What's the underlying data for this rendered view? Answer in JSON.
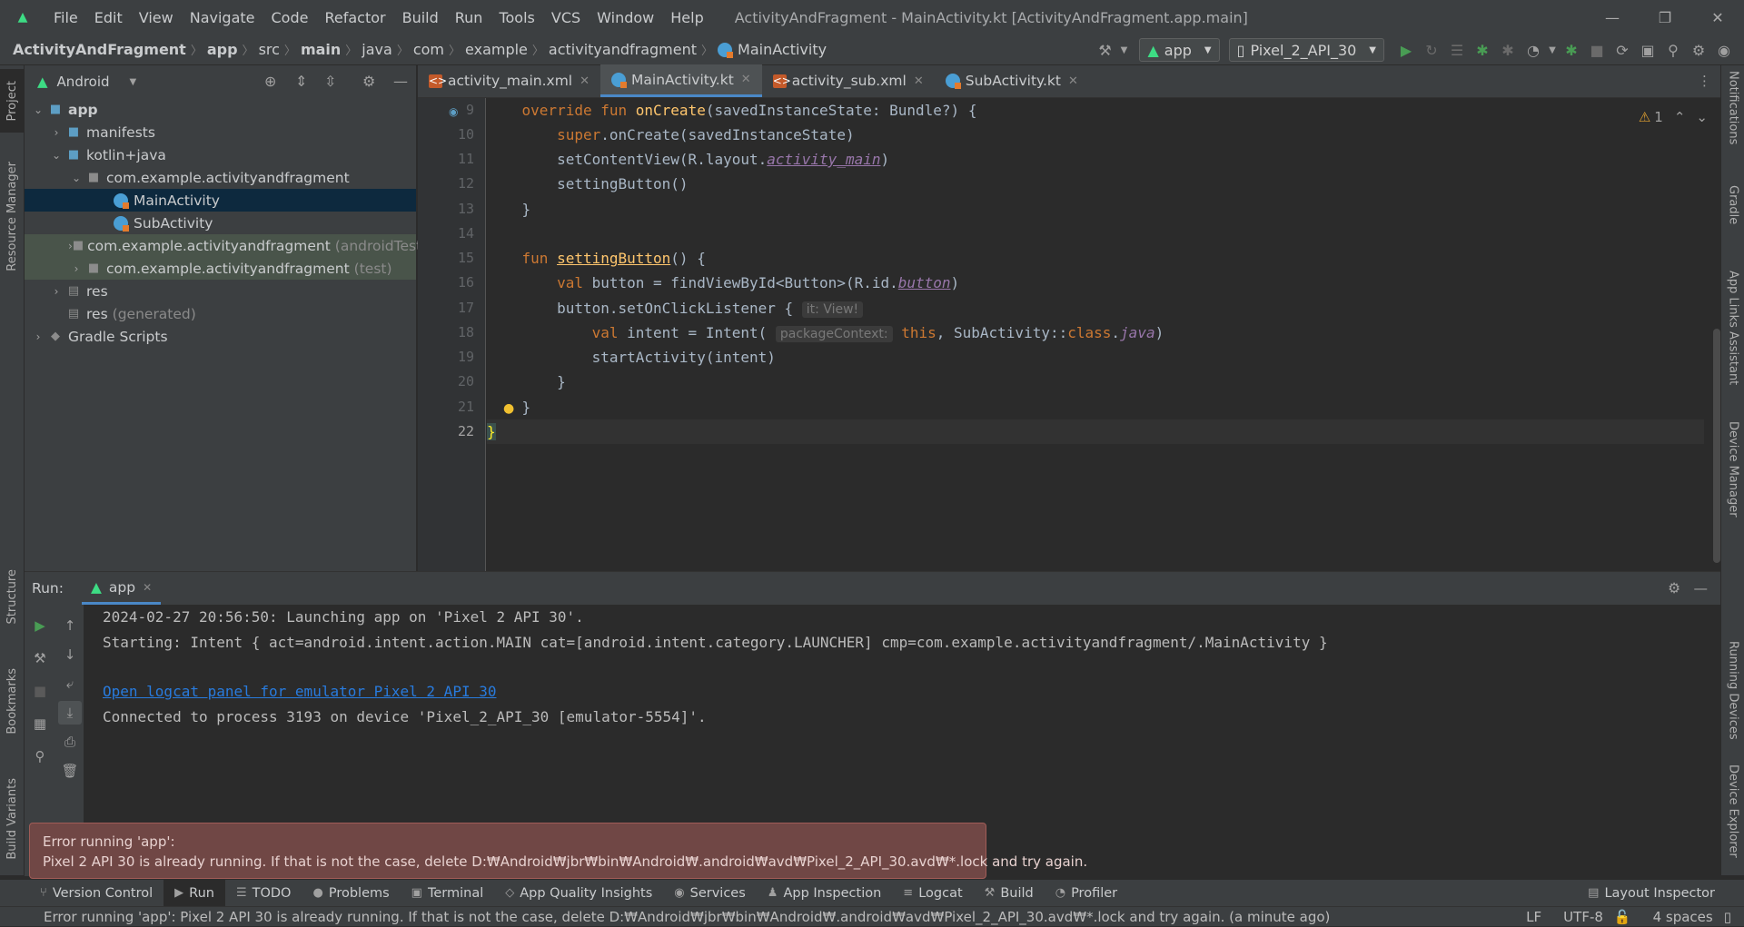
{
  "titlebar": {
    "menu": [
      "File",
      "Edit",
      "View",
      "Navigate",
      "Code",
      "Refactor",
      "Build",
      "Run",
      "Tools",
      "VCS",
      "Window",
      "Help"
    ],
    "title": "ActivityAndFragment - MainActivity.kt [ActivityAndFragment.app.main]"
  },
  "navbar": {
    "crumbs": [
      "ActivityAndFragment",
      "app",
      "src",
      "main",
      "java",
      "com",
      "example",
      "activityandfragment",
      "MainActivity"
    ],
    "run_config": "app",
    "device": "Pixel_2_API_30"
  },
  "left_strip": {
    "project": "Project",
    "resource_manager": "Resource Manager",
    "structure": "Structure",
    "bookmarks": "Bookmarks",
    "build_variants": "Build Variants"
  },
  "right_strip": {
    "notifications": "Notifications",
    "gradle": "Gradle",
    "app_links": "App Links Assistant",
    "device_manager": "Device Manager",
    "running_devices": "Running Devices",
    "device_explorer": "Device Explorer"
  },
  "project": {
    "view": "Android",
    "tree": {
      "app": "app",
      "manifests": "manifests",
      "kotlin_java": "kotlin+java",
      "pkg_main": "com.example.activityandfragment",
      "main_activity": "MainActivity",
      "sub_activity": "SubActivity",
      "pkg_android_test": "com.example.activityandfragment",
      "android_test_tag": "(androidTest)",
      "pkg_test": "com.example.activityandfragment",
      "test_tag": "(test)",
      "res": "res",
      "res_generated": "res",
      "generated_tag": "(generated)",
      "gradle_scripts": "Gradle Scripts"
    }
  },
  "editor": {
    "tabs": [
      "activity_main.xml",
      "MainActivity.kt",
      "activity_sub.xml",
      "SubActivity.kt"
    ],
    "active_tab": "MainActivity.kt",
    "warnings": "1",
    "line_numbers": [
      "9",
      "10",
      "11",
      "12",
      "13",
      "14",
      "15",
      "16",
      "17",
      "18",
      "19",
      "20",
      "21",
      "22"
    ],
    "hints": {
      "it_view": "it: View!",
      "package_context": "packageContext:"
    }
  },
  "run": {
    "label": "Run:",
    "tab": "app",
    "console": {
      "l1": "2024-02-27 20:56:50: Launching app on 'Pixel 2 API 30'.",
      "l2": "Starting: Intent { act=android.intent.action.MAIN cat=[android.intent.category.LAUNCHER] cmp=com.example.activityandfragment/.MainActivity }",
      "link": "Open logcat panel for emulator Pixel 2 API 30",
      "l4": "Connected to process 3193 on device 'Pixel_2_API_30 [emulator-5554]'."
    }
  },
  "error_balloon": {
    "title": "Error running 'app':",
    "message": "Pixel 2 API 30 is already running. If that is not the case, delete D:₩Android₩jbr₩bin₩Android₩.android₩avd₩Pixel_2_API_30.avd₩*.lock and try again."
  },
  "bottom_tabs": [
    "Version Control",
    "Run",
    "TODO",
    "Problems",
    "Terminal",
    "App Quality Insights",
    "Services",
    "App Inspection",
    "Logcat",
    "Build",
    "Profiler"
  ],
  "layout_inspector": "Layout Inspector",
  "status": {
    "message": "Error running 'app': Pixel 2 API 30 is already running. If that is not the case, delete D:₩Android₩jbr₩bin₩Android₩.android₩avd₩Pixel_2_API_30.avd₩*.lock and try again. (a minute ago)",
    "line_sep": "LF",
    "encoding": "UTF-8",
    "indent": "4 spaces"
  },
  "colors": {
    "accent": "#4a88c7",
    "error_bg": "#704745",
    "selection": "#0d293e"
  }
}
